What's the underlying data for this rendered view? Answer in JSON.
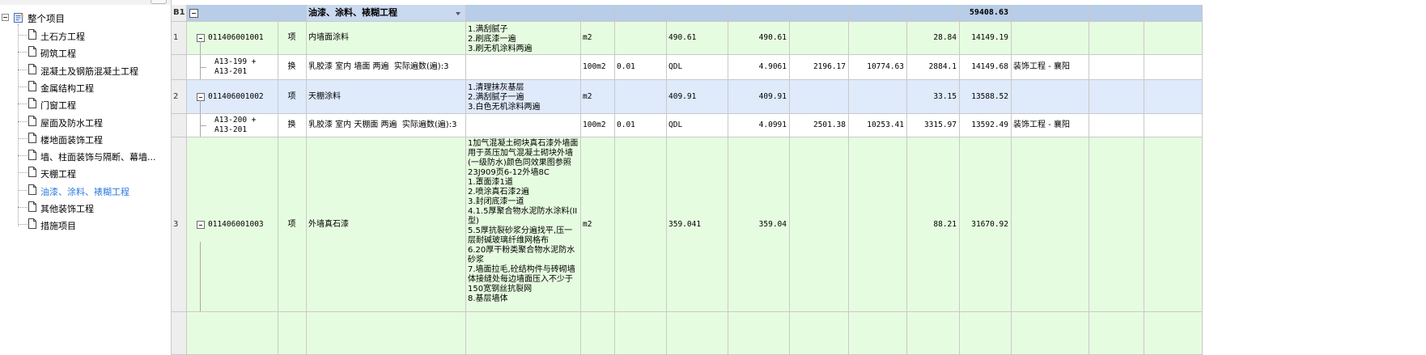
{
  "tree": {
    "root_label": "整个项目",
    "items": [
      {
        "label": "土石方工程",
        "selected": false
      },
      {
        "label": "砌筑工程",
        "selected": false
      },
      {
        "label": "混凝土及钢筋混凝土工程",
        "selected": false
      },
      {
        "label": "金属结构工程",
        "selected": false
      },
      {
        "label": "门窗工程",
        "selected": false
      },
      {
        "label": "屋面及防水工程",
        "selected": false
      },
      {
        "label": "楼地面装饰工程",
        "selected": false
      },
      {
        "label": "墙、柱面装饰与隔断、幕墙...",
        "selected": false
      },
      {
        "label": "天棚工程",
        "selected": false
      },
      {
        "label": "油漆、涂料、裱糊工程",
        "selected": true
      },
      {
        "label": "其他装饰工程",
        "selected": false
      },
      {
        "label": "措施项目",
        "selected": false
      }
    ]
  },
  "grid": {
    "section": {
      "index": "B1",
      "name": "油漆、涂料、裱糊工程",
      "total": "59408.63"
    },
    "rows": [
      {
        "kind": "qd",
        "index": "1",
        "code": "011406001001",
        "type": "项",
        "name": "内墙面涂料",
        "feature": "1.满刮腻子\n2.刷底漆一遍\n3.刷无机涂料两遍",
        "unit": "m2",
        "coef": "",
        "qty_expr": "490.61",
        "qty": "490.61",
        "price": "",
        "amount": "",
        "unit_price": "28.84",
        "total": "14149.19",
        "specialty": ""
      },
      {
        "kind": "sub",
        "index": "",
        "code": "A13-199 +\nA13-201",
        "type": "换",
        "name": "乳胶漆 室内 墙面 两遍  实际遍数(遍):3",
        "feature": "",
        "unit": "100m2",
        "coef": "0.01",
        "qty_expr": "QDL",
        "qty": "4.9061",
        "price": "2196.17",
        "amount": "10774.63",
        "unit_price": "2884.1",
        "total": "14149.68",
        "specialty": "装饰工程 - 襄阳"
      },
      {
        "kind": "qd2",
        "index": "2",
        "code": "011406001002",
        "type": "项",
        "name": "天棚涂料",
        "feature": "1.清理抹灰基层\n2.满刮腻子一遍\n3.白色无机涂料两遍",
        "unit": "m2",
        "coef": "",
        "qty_expr": "409.91",
        "qty": "409.91",
        "price": "",
        "amount": "",
        "unit_price": "33.15",
        "total": "13588.52",
        "specialty": ""
      },
      {
        "kind": "sub",
        "index": "",
        "code": "A13-200 +\nA13-201",
        "type": "换",
        "name": "乳胶漆 室内 天棚面 两遍  实际遍数(遍):3",
        "feature": "",
        "unit": "100m2",
        "coef": "0.01",
        "qty_expr": "QDL",
        "qty": "4.0991",
        "price": "2501.38",
        "amount": "10253.41",
        "unit_price": "3315.97",
        "total": "13592.49",
        "specialty": "装饰工程 - 襄阳"
      },
      {
        "kind": "qd",
        "index": "3",
        "code": "011406001003",
        "type": "项",
        "name": "外墙真石漆",
        "feature": "1加气混凝土砌块真石漆外墙面用于蒸压加气混凝土砌块外墙(一级防水)颜色同效果图参照23J909页6-12外墙8C\n1.罩面漆1道\n2.喷涂真石漆2遍\n3.封闭底漆一道\n4.1.5厚聚合物水泥防水涂料(II型)\n5.5厚抗裂砂浆分遍找平,压一层耐碱玻璃纤维网格布\n6.20厚干粉类聚合物水泥防水砂浆\n7.墙面拉毛,砼结构件与砖砌墙体接缝处每边墙面压入不少于150宽钢丝抗裂网\n8.基层墙体",
        "unit": "m2",
        "coef": "",
        "qty_expr": "359.041",
        "qty": "359.04",
        "price": "",
        "amount": "",
        "unit_price": "88.21",
        "total": "31670.92",
        "specialty": ""
      }
    ]
  },
  "colors": {
    "section_bg": "#b8cde8",
    "qd_bg": "#e6fce0",
    "qd2_bg": "#dfeafb",
    "selection_border": "#2f6fd1",
    "tree_selected_text": "#2a7be0"
  }
}
